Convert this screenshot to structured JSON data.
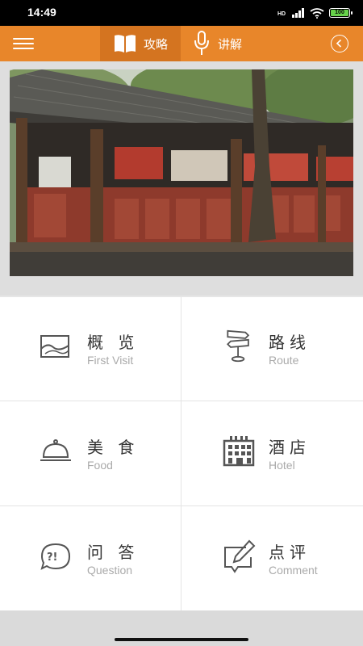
{
  "status_bar": {
    "time": "14:49",
    "battery_level": "100",
    "icons": [
      "hd-icon",
      "signal-icon",
      "wifi-icon",
      "battery-icon"
    ]
  },
  "header": {
    "tabs": [
      {
        "label": "攻略",
        "icon": "book-icon",
        "active": true
      },
      {
        "label": "讲解",
        "icon": "microphone-icon",
        "active": false
      }
    ],
    "accent_color": "#e8862a"
  },
  "menu": [
    {
      "title": "概 览",
      "subtitle": "First Visit",
      "icon": "landscape-icon"
    },
    {
      "title": "路线",
      "subtitle": "Route",
      "icon": "signpost-icon"
    },
    {
      "title": "美 食",
      "subtitle": "Food",
      "icon": "cloche-icon"
    },
    {
      "title": "酒店",
      "subtitle": "Hotel",
      "icon": "hotel-icon"
    },
    {
      "title": "问 答",
      "subtitle": "Question",
      "icon": "question-bubble-icon"
    },
    {
      "title": "点评",
      "subtitle": "Comment",
      "icon": "edit-comment-icon"
    }
  ]
}
